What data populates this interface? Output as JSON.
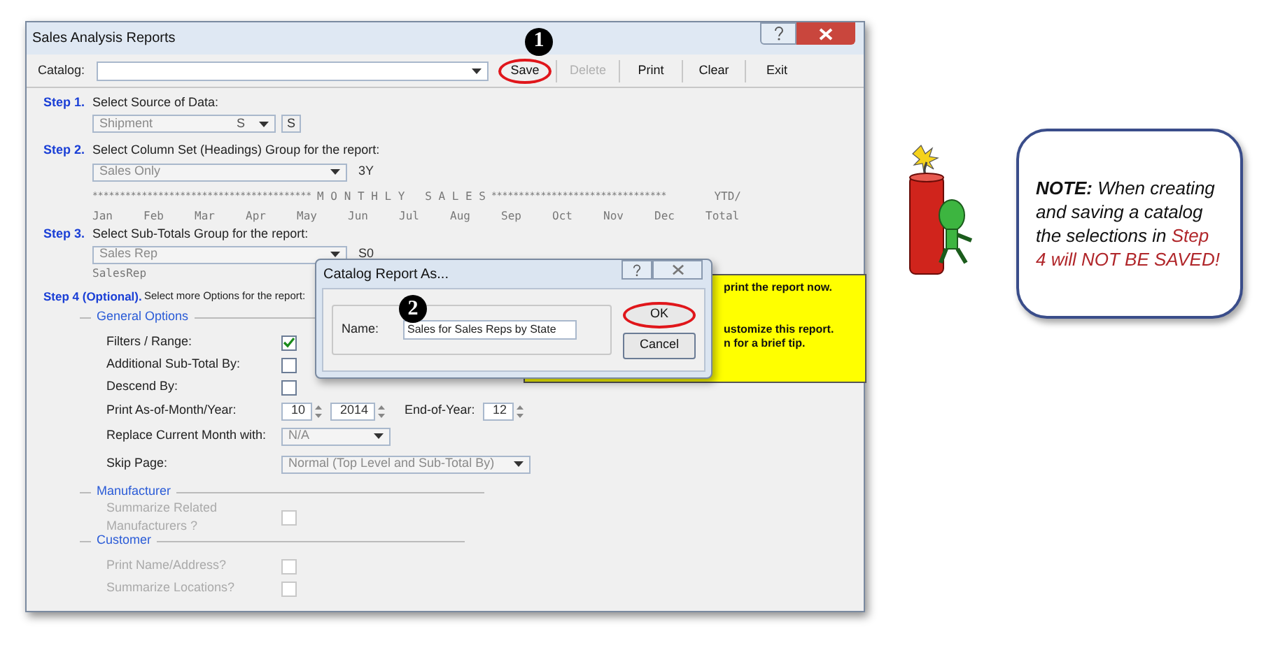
{
  "window": {
    "title": "Sales Analysis Reports"
  },
  "toolbar": {
    "catalog_label": "Catalog:",
    "buttons": [
      {
        "label": "Save",
        "disabled": false,
        "circled": true,
        "marker": "1"
      },
      {
        "label": "Delete",
        "disabled": true,
        "circled": false
      },
      {
        "label": "Print",
        "disabled": false,
        "circled": false
      },
      {
        "label": "Clear",
        "disabled": false,
        "circled": false
      },
      {
        "label": "Exit",
        "disabled": false,
        "circled": false
      }
    ]
  },
  "step1": {
    "label": "Step 1.",
    "prompt": "Select Source of Data:",
    "select": "Shipment",
    "select_code": "S",
    "code_box": "S"
  },
  "step2": {
    "label": "Step 2.",
    "prompt": "Select Column Set (Headings) Group for the report:",
    "select": "Sales Only",
    "code": "3Y",
    "heading": [
      "****************************************",
      "M O N T H L Y   S A L E S",
      "********************************",
      "YTD/"
    ],
    "months": [
      "Jan",
      "Feb",
      "Mar",
      "Apr",
      "May",
      "Jun",
      "Jul",
      "Aug",
      "Sep",
      "Oct",
      "Nov",
      "Dec",
      "Total"
    ]
  },
  "step3": {
    "label": "Step 3.",
    "prompt": "Select Sub-Totals Group for the report:",
    "select": "Sales Rep",
    "code": "S0",
    "detail": "SalesRep"
  },
  "step4": {
    "label": "Step 4 (Optional).",
    "prompt": "Select more Options for the report:",
    "groups": [
      {
        "title": "General Options",
        "items": [
          {
            "kind": "checkbox",
            "label": "Filters / Range:",
            "checked": true,
            "disabled": false
          },
          {
            "kind": "checkbox",
            "label": "Additional Sub-Total By:",
            "checked": false,
            "disabled": false
          },
          {
            "kind": "checkbox",
            "label": "Descend By:",
            "checked": false,
            "disabled": false
          },
          {
            "kind": "spinners",
            "label": "Print As-of-Month/Year:",
            "month": "10",
            "year": "2014",
            "end_label": "End-of-Year:",
            "end_value": "12"
          },
          {
            "kind": "select",
            "label": "Replace Current Month with:",
            "value": "N/A",
            "wide": false
          },
          {
            "kind": "select",
            "label": "Skip Page:",
            "value": "Normal (Top Level and Sub-Total By)",
            "wide": true
          }
        ]
      },
      {
        "title": "Manufacturer",
        "items": [
          {
            "kind": "checkbox",
            "label": "Summarize Related Manufacturers ?",
            "checked": false,
            "disabled": true
          }
        ]
      },
      {
        "title": "Customer",
        "items": [
          {
            "kind": "checkbox",
            "label": "Print Name/Address?",
            "checked": false,
            "disabled": true
          },
          {
            "kind": "checkbox",
            "label": "Summarize Locations?",
            "checked": false,
            "disabled": true
          }
        ]
      }
    ]
  },
  "tip": {
    "lines": [
      "print the report now.",
      "ustomize this report.",
      "n for a brief tip."
    ]
  },
  "dialog": {
    "title": "Catalog Report As...",
    "marker": "2",
    "name_label": "Name:",
    "name_value": "Sales for Sales Reps by State",
    "buttons": [
      {
        "label": "OK",
        "circled": true
      },
      {
        "label": "Cancel",
        "circled": false
      }
    ]
  },
  "note": {
    "lead": "NOTE:",
    "text": "When creating and saving a catalog the selections in",
    "warning": "Step 4 will NOT BE SAVED!"
  }
}
